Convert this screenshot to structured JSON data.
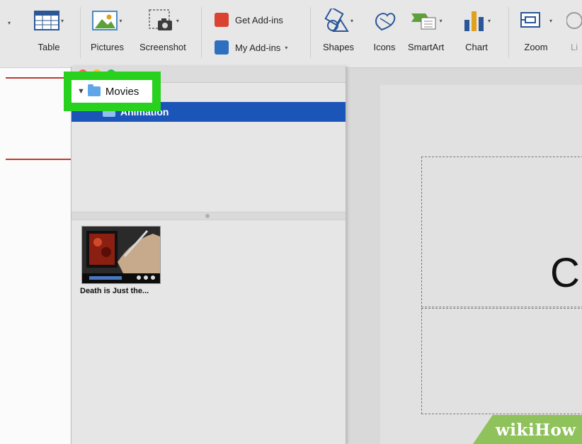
{
  "ribbon": {
    "buttons": [
      {
        "label": "Table",
        "icon": "table-icon"
      },
      {
        "label": "Pictures",
        "icon": "pictures-icon"
      },
      {
        "label": "Screenshot",
        "icon": "screenshot-icon"
      },
      {
        "label": "Shapes",
        "icon": "shapes-icon"
      },
      {
        "label": "Icons",
        "icon": "icons-icon"
      },
      {
        "label": "SmartArt",
        "icon": "smartart-icon"
      },
      {
        "label": "Chart",
        "icon": "chart-icon"
      },
      {
        "label": "Zoom",
        "icon": "zoom-icon"
      },
      {
        "label": "Li",
        "icon": "link-icon"
      }
    ],
    "addins": {
      "get": "Get Add-ins",
      "my": "My Add-ins"
    }
  },
  "media_browser": {
    "tree": {
      "parent": "Movies",
      "child": "Animation"
    },
    "clips": [
      {
        "caption": "Death is Just the..."
      }
    ]
  },
  "slide": {
    "title_fragment": "Cl"
  },
  "watermark": {
    "brand": "wikiHow"
  },
  "colors": {
    "ribbon_bg": "#e7e7e7",
    "selection_blue": "#1c55b8",
    "highlight_green": "#27d11e",
    "doc_red_line": "#c0392b",
    "watermark_green": "#8fc25a"
  }
}
